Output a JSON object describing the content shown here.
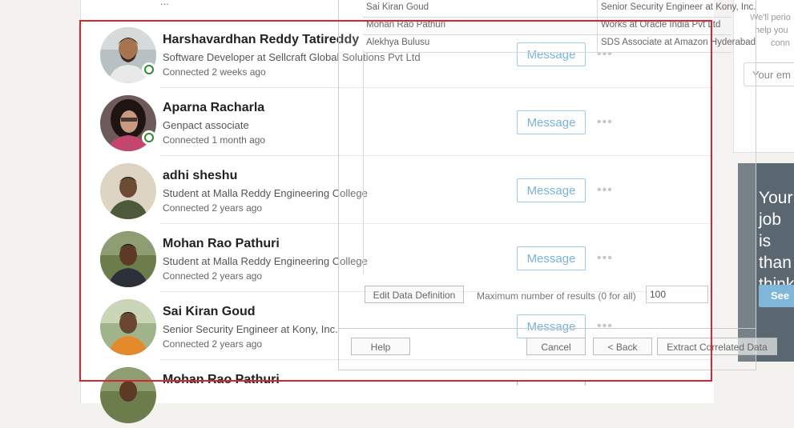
{
  "top_partial_text": "...",
  "connections": [
    {
      "name": "Harshavardhan Reddy Tatireddy",
      "headline": "Software Developer at Sellcraft Global Solutions Pvt Ltd",
      "connected": "Connected 2 weeks ago",
      "online": true,
      "message_label": "Message",
      "more": "•••"
    },
    {
      "name": "Aparna Racharla",
      "headline": "Genpact associate",
      "connected": "Connected 1 month ago",
      "online": true,
      "message_label": "Message",
      "more": "•••"
    },
    {
      "name": "adhi sheshu",
      "headline": "Student at Malla Reddy Engineering College",
      "connected": "Connected 2 years ago",
      "online": false,
      "message_label": "Message",
      "more": "•••"
    },
    {
      "name": "Mohan Rao Pathuri",
      "headline": "Student at Malla Reddy Engineering College",
      "connected": "Connected 2 years ago",
      "online": false,
      "message_label": "Message",
      "more": "•••"
    },
    {
      "name": "Sai Kiran Goud",
      "headline": "Senior Security Engineer at Kony, Inc.",
      "connected": "Connected 2 years ago",
      "online": false,
      "message_label": "Message",
      "more": "•••"
    },
    {
      "name": "Mohan Rao Pathuri",
      "headline": "",
      "connected": "",
      "online": false,
      "message_label": "",
      "more": ""
    }
  ],
  "right_panel": {
    "text_line1": "We'll perio",
    "text_line2": "help you",
    "text_line3": "conn",
    "input_placeholder": "Your em"
  },
  "ad": {
    "lines": [
      "Your",
      "job is",
      "than",
      "think"
    ],
    "button": "See"
  },
  "ghost_dialog": {
    "rows": [
      {
        "name": "Sai Kiran Goud",
        "title": "Senior Security Engineer at Kony, Inc."
      },
      {
        "name": "Mohan Rao Pathuri",
        "title": "Works at Oracle India Pvt Ltd"
      },
      {
        "name": "Alekhya Bulusu",
        "title": "SDS Associate at Amazon Hyderabad"
      }
    ],
    "edit_button": "Edit Data Definition",
    "max_label": "Maximum number of results (0 for all)",
    "max_value": "100",
    "help_button": "Help",
    "cancel_button": "Cancel",
    "back_button": "< Back",
    "extract_button": "Extract Correlated Data"
  },
  "colors": {
    "accent": "#5ea3d6",
    "online": "#2e8a33",
    "selection": "#d9262e",
    "ad_bg": "#5b6770"
  },
  "icons": [
    "online-status-icon",
    "more-options-icon"
  ]
}
